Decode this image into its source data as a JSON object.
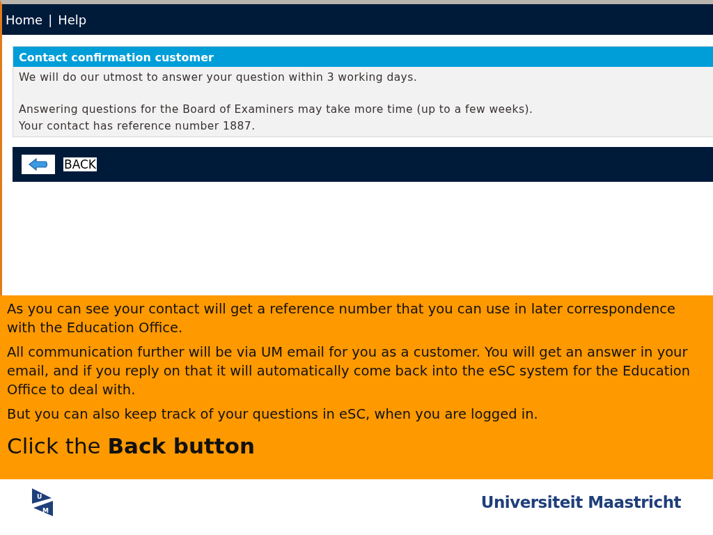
{
  "nav": {
    "links": [
      "Home",
      "Help"
    ],
    "separator": "|"
  },
  "panel": {
    "title": "Contact confirmation customer",
    "paragraphs": [
      [
        "We will do our utmost to answer your question within 3 working days."
      ],
      [
        "Answering questions for the Board of Examiners may take more time (up to a few weeks).",
        "Your contact has reference number 1887."
      ]
    ]
  },
  "back_bar": {
    "label": "BACK"
  },
  "notes": [
    "As you can see your contact will get a reference number that you can use in later correspondence with the Education Office.",
    "All communication further will be via UM email for you as a customer. You will get an answer in your email, and if you reply on that it will automatically come back into the eSC system for the Education Office to deal with.",
    "But you can also keep track of your questions in eSC, when you are logged in."
  ],
  "instruction": "Click the **Back button**",
  "footer": {
    "logo_letters": [
      "U",
      "M"
    ],
    "university": "Universiteit Maastricht"
  }
}
